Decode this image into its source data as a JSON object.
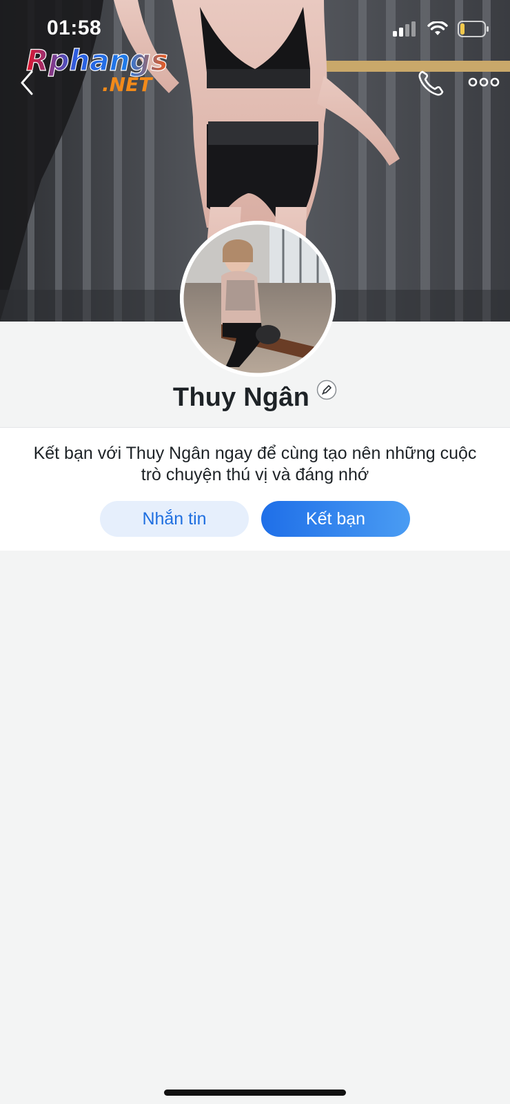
{
  "status_bar": {
    "time": "01:58",
    "battery_color": "#f2c94c"
  },
  "watermark": {
    "line1": "Rphangs",
    "line2": ".NET"
  },
  "navigation": {
    "back_icon": "chevron-left-icon",
    "call_icon": "phone-icon",
    "more_icon": "more-horizontal-icon"
  },
  "profile": {
    "name": "Thuy Ngân",
    "edit_icon": "pencil-icon"
  },
  "friend_prompt": {
    "text": "Kết bạn với Thuy Ngân ngay để cùng tạo nên những cuộc trò chuyện thú vị và đáng nhớ",
    "message_button": "Nhắn tin",
    "add_friend_button": "Kết bạn"
  },
  "colors": {
    "accent": "#1f6fe8",
    "accent_light": "#e6effc",
    "background": "#f3f4f4",
    "text": "#1e2327"
  }
}
